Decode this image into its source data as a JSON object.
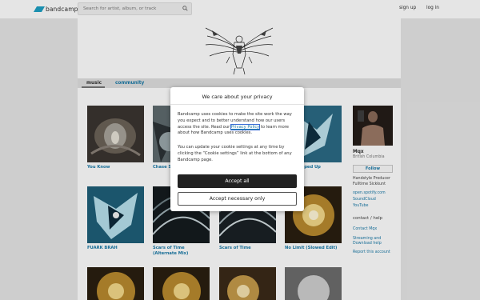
{
  "header": {
    "logo_text": "bandcamp",
    "search_placeholder": "Search for artist, album, or track",
    "signup": "sign up",
    "login": "log in"
  },
  "tabs": {
    "music": "music",
    "community": "community"
  },
  "albums": [
    {
      "title": "You Know"
    },
    {
      "title": "Chase S"
    },
    {
      "title": ""
    },
    {
      "title": "BRAH (Sped Up"
    },
    {
      "title": "FUARK BRAH"
    },
    {
      "title": "Scars of Time (Alternate Mix)"
    },
    {
      "title": "Scars of Time"
    },
    {
      "title": "No Limit (Slowed Edit)"
    }
  ],
  "sidebar": {
    "artist_name": "Mqx",
    "location": "British Columbia",
    "follow": "Follow",
    "bio_line1": "Handstyle Producer",
    "bio_line2": "Fulltime Sickkunt",
    "links": [
      "open.spotify.com",
      "SoundCloud",
      "YouTube"
    ],
    "contact_heading": "contact / help",
    "contact_link": "Contact Mqx",
    "streaming_line1": "Streaming and",
    "streaming_line2": "Download help",
    "report": "Report this account"
  },
  "modal": {
    "title": "We care about your privacy",
    "p1_before": "Bandcamp uses cookies to make the site work the way you expect and to better understand how our users access the site. Read our ",
    "privacy_link": "Privacy Policy",
    "p1_after": " to learn more about how Bandcamp uses cookies.",
    "p2": "You can update your cookie settings at any time by clicking the “Cookie settings” link at the bottom of any Bandcamp page.",
    "accept_all": "Accept all",
    "accept_necessary": "Accept necessary only"
  },
  "colors": {
    "link": "#1a7aa8",
    "brand": "#1da0c3",
    "accept_button": "#222222"
  }
}
